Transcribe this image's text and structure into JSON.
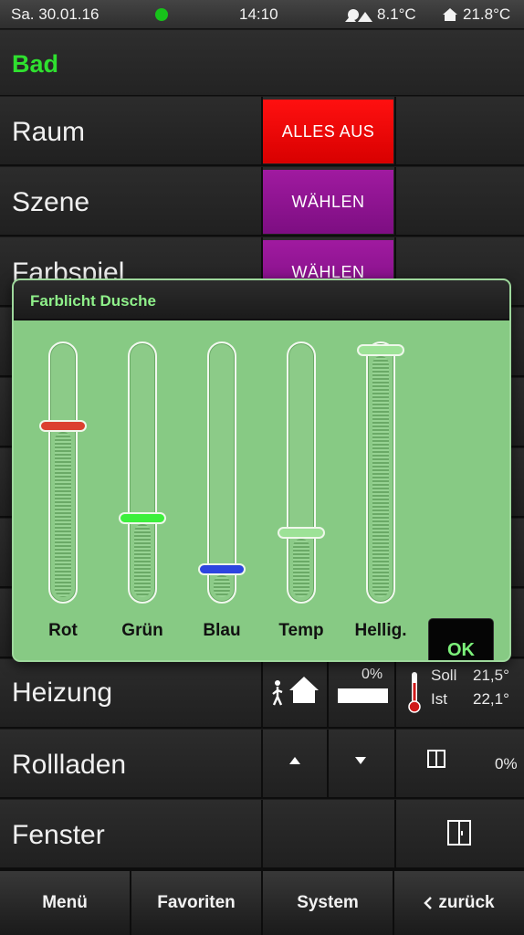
{
  "status": {
    "date": "Sa. 30.01.16",
    "time": "14:10",
    "outdoor_temp": "8.1°C",
    "indoor_temp": "21.8°C",
    "connection_color": "#17c21a"
  },
  "page": {
    "title": "Bad"
  },
  "rows": {
    "raum": {
      "label": "Raum",
      "button": "ALLES AUS"
    },
    "szene": {
      "label": "Szene",
      "button": "WÄHLEN"
    },
    "farbspiel": {
      "label": "Farbspiel",
      "button": "WÄHLEN"
    },
    "heizung": {
      "label": "Heizung",
      "valve": "0%",
      "valve_level": 0,
      "soll_label": "Soll",
      "soll_value": "21,5°",
      "ist_label": "Ist",
      "ist_value": "22,1°"
    },
    "rollladen": {
      "label": "Rollladen",
      "position": "0%"
    },
    "fenster": {
      "label": "Fenster"
    }
  },
  "dialog": {
    "title": "Farblicht Dusche",
    "ok": "OK",
    "sliders": [
      {
        "label": "Rot",
        "level": 0.69,
        "handle_color": "#dc4030"
      },
      {
        "label": "Grün",
        "level": 0.31,
        "handle_color": "#3cf03c"
      },
      {
        "label": "Blau",
        "level": 0.1,
        "handle_color": "#2d45e0"
      },
      {
        "label": "Temp",
        "level": 0.25,
        "handle_color": "#9de297"
      },
      {
        "label": "Hellig.",
        "level": 1.0,
        "handle_color": "#9de297"
      }
    ]
  },
  "nav": {
    "menu": "Menü",
    "favorites": "Favoriten",
    "system": "System",
    "back": "zurück"
  },
  "icons": {
    "status": [
      "connection-dot-icon",
      "outdoor-icon",
      "home-icon"
    ],
    "rows": [
      "presence-home-icon",
      "thermometer-icon",
      "arrow-up-icon",
      "arrow-down-icon",
      "window-icon",
      "window-sash-icon"
    ],
    "nav": [
      "chevron-left-icon"
    ]
  }
}
